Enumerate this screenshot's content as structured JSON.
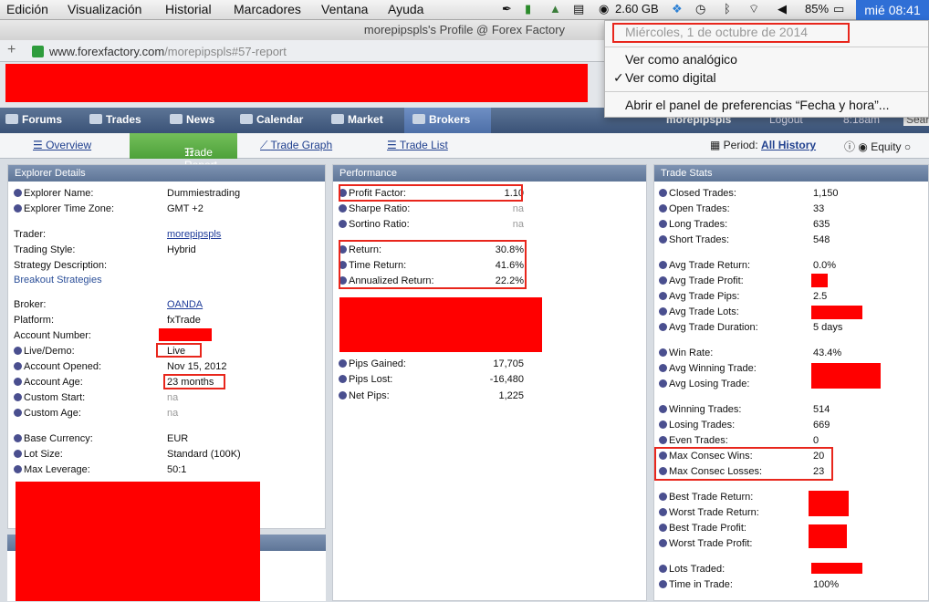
{
  "menubar": {
    "items": [
      "Edición",
      "Visualización",
      "Historial",
      "Marcadores",
      "Ventana",
      "Ayuda"
    ],
    "memory": "2.60 GB",
    "battery": "85%",
    "clock": "mié 08:41"
  },
  "window_title": "morepipspls's Profile @ Forex Factory",
  "url": {
    "host": "www.forexfactory.com",
    "path": "/morepipspls#57-report"
  },
  "clock_menu": {
    "date": "Miércoles, 1 de octubre de 2014",
    "analog": "Ver como analógico",
    "digital": "Ver como digital",
    "checkmark": "✓",
    "prefs": "Abrir el panel de preferencias “Fecha y hora”..."
  },
  "nav": {
    "items": [
      "Forums",
      "Trades",
      "News",
      "Calendar",
      "Market",
      "Brokers"
    ],
    "user": "morepipspls",
    "logout": "Logout",
    "time": "8:18am",
    "search": "Sear"
  },
  "subnav": {
    "tabs": [
      "Overview",
      "Trade Report",
      "Trade Graph",
      "Trade List"
    ],
    "period_label": "Period:",
    "period_value": "All History",
    "equity": "Equity"
  },
  "explorer": {
    "title": "Explorer Details",
    "rows": [
      {
        "label": "Explorer Name:",
        "value": "Dummiestrading"
      },
      {
        "label": "Explorer Time Zone:",
        "value": "GMT +2"
      },
      {
        "label": "Trader:",
        "value": "morepipspls"
      },
      {
        "label": "Trading Style:",
        "value": "Hybrid"
      },
      {
        "label": "Strategy Description:",
        "value": ""
      },
      {
        "label": "Breakout Strategies",
        "value": ""
      },
      {
        "label": "Broker:",
        "value": "OANDA"
      },
      {
        "label": "Platform:",
        "value": "fxTrade"
      },
      {
        "label": "Account Number:",
        "value": ""
      },
      {
        "label": "Live/Demo:",
        "value": "Live"
      },
      {
        "label": "Account Opened:",
        "value": "Nov 15, 2012"
      },
      {
        "label": "Account Age:",
        "value": "23 months"
      },
      {
        "label": "Custom Start:",
        "value": "na"
      },
      {
        "label": "Custom Age:",
        "value": "na"
      },
      {
        "label": "Base Currency:",
        "value": "EUR"
      },
      {
        "label": "Lot Size:",
        "value": "Standard (100K)"
      },
      {
        "label": "Max Leverage:",
        "value": "50:1"
      }
    ]
  },
  "performance": {
    "title": "Performance",
    "rows": [
      {
        "label": "Profit Factor:",
        "value": "1.10"
      },
      {
        "label": "Sharpe Ratio:",
        "value": "na"
      },
      {
        "label": "Sortino Ratio:",
        "value": "na"
      },
      {
        "label": "Return:",
        "value": "30.8%"
      },
      {
        "label": "Time Return:",
        "value": "41.6%"
      },
      {
        "label": "Annualized Return:",
        "value": "22.2%"
      },
      {
        "label": "Pips Gained:",
        "value": "17,705"
      },
      {
        "label": "Pips Lost:",
        "value": "-16,480"
      },
      {
        "label": "Net Pips:",
        "value": "1,225"
      }
    ]
  },
  "stats": {
    "title": "Trade Stats",
    "rows": [
      {
        "label": "Closed Trades:",
        "value": "1,150"
      },
      {
        "label": "Open Trades:",
        "value": "33"
      },
      {
        "label": "Long Trades:",
        "value": "635"
      },
      {
        "label": "Short Trades:",
        "value": "548"
      },
      {
        "label": "Avg Trade Return:",
        "value": "0.0%"
      },
      {
        "label": "Avg Trade Profit:",
        "value": ""
      },
      {
        "label": "Avg Trade Pips:",
        "value": "2.5"
      },
      {
        "label": "Avg Trade Lots:",
        "value": ""
      },
      {
        "label": "Avg Trade Duration:",
        "value": "5 days"
      },
      {
        "label": "Win Rate:",
        "value": "43.4%"
      },
      {
        "label": "Avg Winning Trade:",
        "value": ""
      },
      {
        "label": "Avg Losing Trade:",
        "value": ""
      },
      {
        "label": "Winning Trades:",
        "value": "514"
      },
      {
        "label": "Losing Trades:",
        "value": "669"
      },
      {
        "label": "Even Trades:",
        "value": "0"
      },
      {
        "label": "Max Consec Wins:",
        "value": "20"
      },
      {
        "label": "Max Consec Losses:",
        "value": "23"
      },
      {
        "label": "Best Trade Return:",
        "value": ""
      },
      {
        "label": "Worst Trade Return:",
        "value": ""
      },
      {
        "label": "Best Trade Profit:",
        "value": ""
      },
      {
        "label": "Worst Trade Profit:",
        "value": ""
      },
      {
        "label": "Lots Traded:",
        "value": ""
      },
      {
        "label": "Time in Trade:",
        "value": "100%"
      }
    ]
  }
}
